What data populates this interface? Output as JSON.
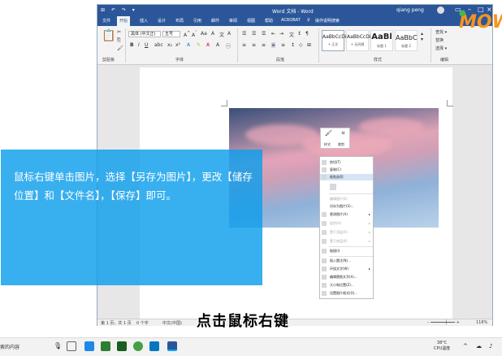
{
  "window": {
    "title": "Word 文档 - Word",
    "user": "qiang peng",
    "quick_access": "⊞ ↶ ↷ ▾"
  },
  "ribbon_tabs": [
    "文件",
    "开始",
    "插入",
    "设计",
    "布局",
    "引用",
    "邮件",
    "审阅",
    "视图",
    "帮助",
    "ACROBAT",
    "操作说明搜索"
  ],
  "ribbon": {
    "font_name": "黑体 (中文正)",
    "font_size": "五号",
    "groups": [
      "剪贴板",
      "字体",
      "段落",
      "样式",
      "编辑"
    ],
    "styles": [
      {
        "sample": "AaBbCcDi",
        "name": "+ 正文"
      },
      {
        "sample": "AaBbCcDi",
        "name": "+ 无间隔"
      },
      {
        "sample": "AaBl",
        "name": "标题 1"
      },
      {
        "sample": "AaBbC",
        "name": "标题 2"
      }
    ],
    "editing": [
      "查找 ▾",
      "替换",
      "选择 ▾"
    ]
  },
  "mini_toolbar": {
    "style_label": "样式",
    "crop_label": "裁剪"
  },
  "context_menu": [
    {
      "label": "剪切(T)",
      "disabled": false,
      "arrow": false
    },
    {
      "label": "复制(C)",
      "disabled": false,
      "arrow": false
    },
    {
      "label": "粘贴选项:",
      "disabled": false,
      "arrow": false,
      "highlight": true
    },
    {
      "label": "",
      "disabled": false,
      "arrow": false
    },
    {
      "label": "编辑图片(E)",
      "disabled": true,
      "arrow": false
    },
    {
      "label": "另存为图片(S)...",
      "disabled": false,
      "arrow": false
    },
    {
      "label": "更改图片(A)",
      "disabled": false,
      "arrow": true
    },
    {
      "label": "组合(G)",
      "disabled": true,
      "arrow": true
    },
    {
      "label": "置于顶层(R)",
      "disabled": true,
      "arrow": true
    },
    {
      "label": "置于底层(K)",
      "disabled": true,
      "arrow": true
    },
    {
      "label": "链接(I)",
      "disabled": false,
      "arrow": false
    },
    {
      "label": "插入题注(N)...",
      "disabled": false,
      "arrow": false
    },
    {
      "label": "环绕文字(W)",
      "disabled": false,
      "arrow": true
    },
    {
      "label": "编辑替换文字(A)...",
      "disabled": false,
      "arrow": false
    },
    {
      "label": "大小和位置(Z)...",
      "disabled": false,
      "arrow": false
    },
    {
      "label": "设置图片格式(O)...",
      "disabled": false,
      "arrow": false
    }
  ],
  "statusbar": {
    "page": "第 1 页，共 1 页",
    "words": "0 个字",
    "lang": "中文(中国)",
    "zoom": "116%"
  },
  "overlay": {
    "instruction": "鼠标右键单击图片，选择【另存为图片】，更改【储存位置】和【文件名】，【保存】即可。",
    "subtitle": "点击鼠标右键"
  },
  "taskbar": {
    "search_text": "索的内容",
    "temp": "38°C",
    "cpu_label": "CPU温度"
  },
  "logo": {
    "text": "MOW"
  }
}
